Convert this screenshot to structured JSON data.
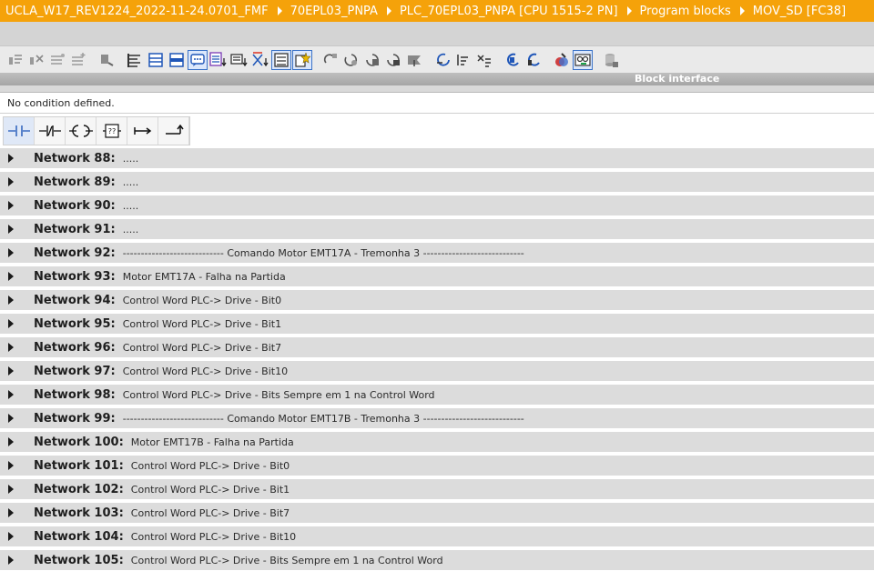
{
  "breadcrumb": [
    "UCLA_W17_REV1224_2022-11-24.0701_FMF",
    "70EPL03_PNPA",
    "PLC_70EPL03_PNPA [CPU 1515-2 PN]",
    "Program blocks",
    "MOV_SD [FC38]"
  ],
  "colors": {
    "title_bar": "#f5a20a",
    "network_row": "#dcdcdc",
    "toolbar": "#eaeaea",
    "active_button_border": "#3b73c8"
  },
  "toolbar": {
    "icons": [
      "insert-network-icon",
      "delete-network-icon",
      "insert-row-icon",
      "add-row-icon",
      "reset-start-values-icon",
      "open-all-networks-icon",
      "close-all-networks-icon",
      "navigation-icon",
      "show-comments-icon",
      "absolute-operands-icon",
      "show-favorites-icon",
      "go-to-first-error-icon",
      "go-to-next-error-icon",
      "update-calls-icon",
      "monitoring-icon",
      "compare-icon",
      "block-interface-icon",
      "download-icon",
      "display-icon"
    ]
  },
  "block_interface": {
    "label": "Block interface"
  },
  "condition": {
    "text": "No condition defined."
  },
  "lad_palette": {
    "items": [
      "normally-open-contact-icon",
      "normally-closed-contact-icon",
      "output-coil-icon",
      "empty-box-icon",
      "open-branch-icon",
      "close-branch-icon"
    ]
  },
  "networks": [
    {
      "name": "Network 88:",
      "comment": "....."
    },
    {
      "name": "Network 89:",
      "comment": "....."
    },
    {
      "name": "Network 90:",
      "comment": "....."
    },
    {
      "name": "Network 91:",
      "comment": "....."
    },
    {
      "name": "Network 92:",
      "comment": "---------------------------- Comando Motor EMT17A - Tremonha 3 ----------------------------"
    },
    {
      "name": "Network 93:",
      "comment": "Motor EMT17A - Falha na Partida"
    },
    {
      "name": "Network 94:",
      "comment": "Control Word PLC-> Drive - Bit0"
    },
    {
      "name": "Network 95:",
      "comment": "Control Word PLC-> Drive - Bit1"
    },
    {
      "name": "Network 96:",
      "comment": "Control Word PLC-> Drive - Bit7"
    },
    {
      "name": "Network 97:",
      "comment": "Control Word PLC-> Drive - Bit10"
    },
    {
      "name": "Network 98:",
      "comment": "Control Word PLC-> Drive - Bits Sempre em 1 na Control Word"
    },
    {
      "name": "Network 99:",
      "comment": "---------------------------- Comando Motor EMT17B - Tremonha 3 ----------------------------"
    },
    {
      "name": "Network 100:",
      "comment": "Motor EMT17B - Falha na Partida"
    },
    {
      "name": "Network 101:",
      "comment": "Control Word PLC-> Drive - Bit0"
    },
    {
      "name": "Network 102:",
      "comment": "Control Word PLC-> Drive - Bit1"
    },
    {
      "name": "Network 103:",
      "comment": "Control Word PLC-> Drive - Bit7"
    },
    {
      "name": "Network 104:",
      "comment": "Control Word PLC-> Drive - Bit10"
    },
    {
      "name": "Network 105:",
      "comment": "Control Word PLC-> Drive - Bits Sempre em 1 na Control Word"
    }
  ]
}
